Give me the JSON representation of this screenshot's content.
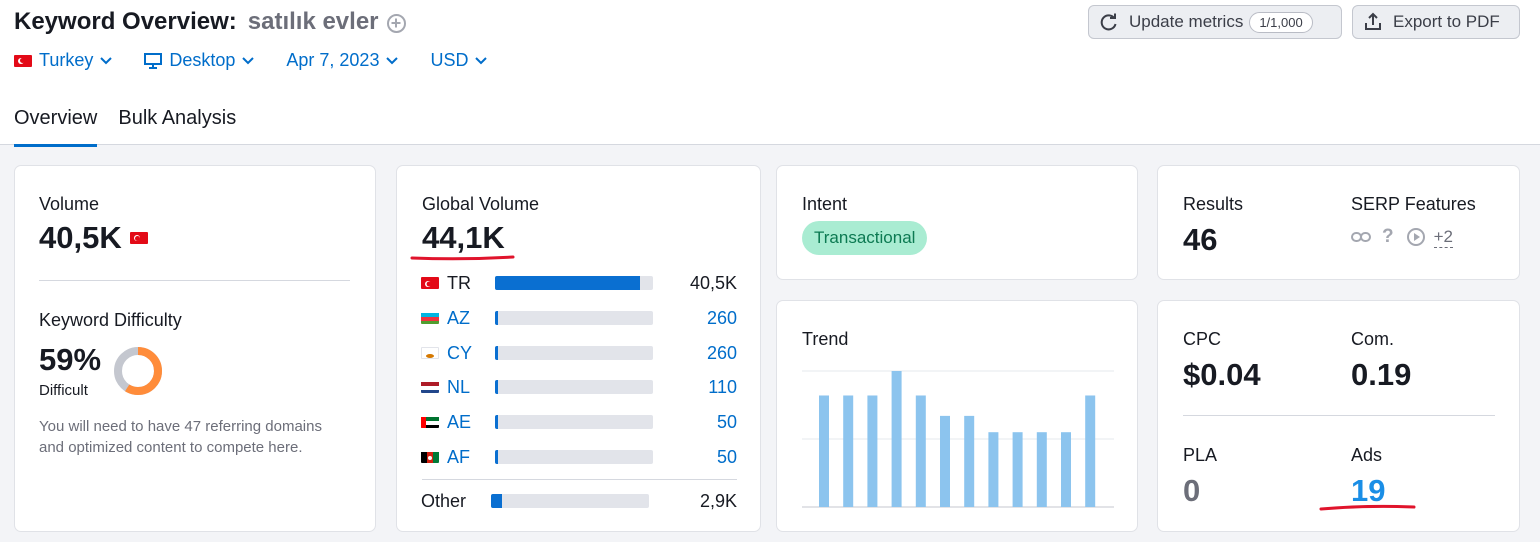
{
  "header": {
    "title": "Keyword Overview:",
    "keyword": "satılık evler",
    "update_button": "Update metrics",
    "update_counter": "1/1,000",
    "export_button": "Export to PDF"
  },
  "filters": {
    "country": "Turkey",
    "device": "Desktop",
    "date": "Apr 7, 2023",
    "currency": "USD"
  },
  "tabs": [
    {
      "label": "Overview",
      "active": true
    },
    {
      "label": "Bulk Analysis",
      "active": false
    }
  ],
  "volume": {
    "label": "Volume",
    "value": "40,5K"
  },
  "keyword_difficulty": {
    "label": "Keyword Difficulty",
    "value": "59%",
    "percent": 59,
    "level": "Difficult",
    "note_line1": "You will need to have 47 referring domains",
    "note_line2": "and optimized content to compete here.",
    "color": "#ff8c3a"
  },
  "global_volume": {
    "label": "Global Volume",
    "value": "44,1K",
    "countries": [
      {
        "code": "TR",
        "value": "40,5K",
        "share": 0.92,
        "flag": "turkey-flag"
      },
      {
        "code": "AZ",
        "value": "260",
        "share": 0.02,
        "flag": "azerbaijan-flag"
      },
      {
        "code": "CY",
        "value": "260",
        "share": 0.02,
        "flag": "cyprus-flag"
      },
      {
        "code": "NL",
        "value": "110",
        "share": 0.02,
        "flag": "netherlands-flag"
      },
      {
        "code": "AE",
        "value": "50",
        "share": 0.02,
        "flag": "uae-flag"
      },
      {
        "code": "AF",
        "value": "50",
        "share": 0.02,
        "flag": "afghanistan-flag"
      }
    ],
    "other": {
      "label": "Other",
      "value": "2,9K",
      "share": 0.07
    }
  },
  "intent": {
    "label": "Intent",
    "badge": "Transactional",
    "badge_color": "#a9ecd2"
  },
  "trend": {
    "label": "Trend"
  },
  "chart_data": {
    "type": "bar",
    "values": [
      0.82,
      0.82,
      0.82,
      1.0,
      0.82,
      0.67,
      0.67,
      0.55,
      0.55,
      0.55,
      0.55,
      0.82
    ],
    "ylim": [
      0,
      1
    ],
    "grid": true,
    "color": "#8cc4ee"
  },
  "results": {
    "label": "Results",
    "value": "46"
  },
  "serp_features": {
    "label": "SERP Features",
    "icons": [
      "link-icon",
      "question-icon",
      "video-icon"
    ],
    "more": "+2"
  },
  "cpc": {
    "label": "CPC",
    "value": "$0.04"
  },
  "competition": {
    "label": "Com.",
    "value": "0.19"
  },
  "pla": {
    "label": "PLA",
    "value": "0"
  },
  "ads": {
    "label": "Ads",
    "value": "19"
  },
  "colors": {
    "accent": "#006dca",
    "annotation": "#e0142c"
  }
}
